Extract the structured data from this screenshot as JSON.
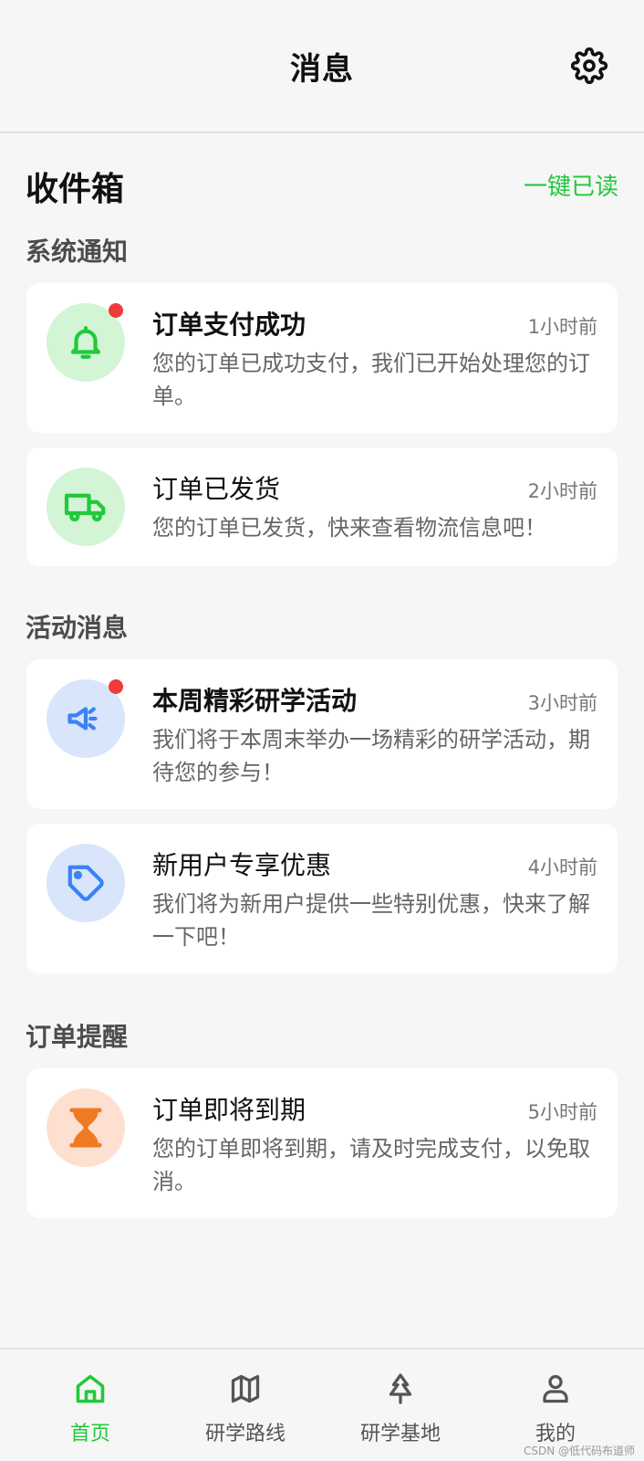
{
  "header": {
    "title": "消息",
    "settings_icon": "gear-icon"
  },
  "inbox": {
    "title": "收件箱",
    "mark_all_read": "一键已读"
  },
  "sections": [
    {
      "title": "系统通知",
      "items": [
        {
          "icon": "bell-icon",
          "title": "订单支付成功",
          "time": "1小时前",
          "body": "您的订单已成功支付，我们已开始处理您的订单。",
          "unread": true,
          "color": "#22c93a",
          "bg": "#d3f5d6"
        },
        {
          "icon": "truck-icon",
          "title": "订单已发货",
          "time": "2小时前",
          "body": "您的订单已发货，快来查看物流信息吧！",
          "unread": false,
          "color": "#22c93a",
          "bg": "#d3f5d6"
        }
      ]
    },
    {
      "title": "活动消息",
      "items": [
        {
          "icon": "megaphone-icon",
          "title": "本周精彩研学活动",
          "time": "3小时前",
          "body": "我们将于本周末举办一场精彩的研学活动，期待您的参与！",
          "unread": true,
          "color": "#3b82f6",
          "bg": "#d8e5fb"
        },
        {
          "icon": "tag-icon",
          "title": "新用户专享优惠",
          "time": "4小时前",
          "body": "我们将为新用户提供一些特别优惠，快来了解一下吧！",
          "unread": false,
          "color": "#3b82f6",
          "bg": "#d8e5fb"
        }
      ]
    },
    {
      "title": "订单提醒",
      "items": [
        {
          "icon": "hourglass-icon",
          "title": "订单即将到期",
          "time": "5小时前",
          "body": "您的订单即将到期，请及时完成支付，以免取消。",
          "unread": false,
          "color": "#f07a22",
          "bg": "#fde0cf"
        }
      ]
    }
  ],
  "bottom_nav": [
    {
      "label": "首页",
      "icon": "home-icon",
      "active": true
    },
    {
      "label": "研学路线",
      "icon": "map-icon",
      "active": false
    },
    {
      "label": "研学基地",
      "icon": "tree-icon",
      "active": false
    },
    {
      "label": "我的",
      "icon": "user-icon",
      "active": false
    }
  ],
  "watermark": "CSDN @低代码布道师",
  "colors": {
    "accent": "#22c93a",
    "unread_dot": "#ef3b3b"
  }
}
